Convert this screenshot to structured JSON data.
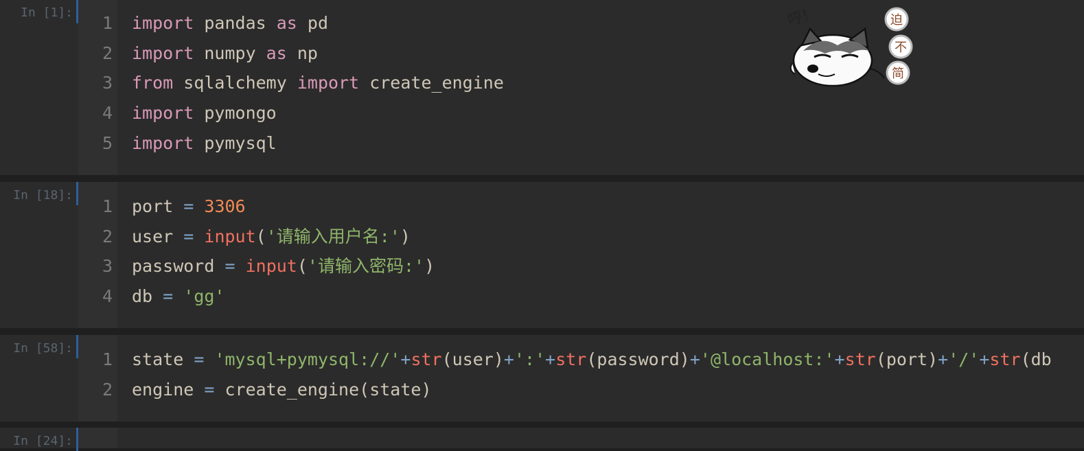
{
  "cells": [
    {
      "prompt": "In [1]:",
      "lines": [
        {
          "n": "1",
          "tokens": [
            {
              "t": "import",
              "c": "kw"
            },
            {
              "t": " pandas ",
              "c": "plain"
            },
            {
              "t": "as",
              "c": "kw"
            },
            {
              "t": " pd",
              "c": "plain"
            }
          ]
        },
        {
          "n": "2",
          "tokens": [
            {
              "t": "import",
              "c": "kw"
            },
            {
              "t": " numpy ",
              "c": "plain"
            },
            {
              "t": "as",
              "c": "kw"
            },
            {
              "t": " np",
              "c": "plain"
            }
          ]
        },
        {
          "n": "3",
          "tokens": [
            {
              "t": "from",
              "c": "kw"
            },
            {
              "t": " sqlalchemy ",
              "c": "plain"
            },
            {
              "t": "import",
              "c": "kw"
            },
            {
              "t": " create_engine",
              "c": "plain"
            }
          ]
        },
        {
          "n": "4",
          "tokens": [
            {
              "t": "import",
              "c": "kw"
            },
            {
              "t": " pymongo",
              "c": "plain"
            }
          ]
        },
        {
          "n": "5",
          "tokens": [
            {
              "t": "import",
              "c": "kw"
            },
            {
              "t": " pymysql",
              "c": "plain"
            }
          ]
        }
      ]
    },
    {
      "prompt": "In [18]:",
      "lines": [
        {
          "n": "1",
          "tokens": [
            {
              "t": "port ",
              "c": "plain"
            },
            {
              "t": "=",
              "c": "op"
            },
            {
              "t": " ",
              "c": "plain"
            },
            {
              "t": "3306",
              "c": "num"
            }
          ]
        },
        {
          "n": "2",
          "tokens": [
            {
              "t": "user ",
              "c": "plain"
            },
            {
              "t": "=",
              "c": "op"
            },
            {
              "t": " ",
              "c": "plain"
            },
            {
              "t": "input",
              "c": "fn"
            },
            {
              "t": "(",
              "c": "plain"
            },
            {
              "t": "'请输入用户名:'",
              "c": "str"
            },
            {
              "t": ")",
              "c": "plain"
            }
          ]
        },
        {
          "n": "3",
          "tokens": [
            {
              "t": "password ",
              "c": "plain"
            },
            {
              "t": "=",
              "c": "op"
            },
            {
              "t": " ",
              "c": "plain"
            },
            {
              "t": "input",
              "c": "fn"
            },
            {
              "t": "(",
              "c": "plain"
            },
            {
              "t": "'请输入密码:'",
              "c": "str"
            },
            {
              "t": ")",
              "c": "plain"
            }
          ]
        },
        {
          "n": "4",
          "tokens": [
            {
              "t": "db ",
              "c": "plain"
            },
            {
              "t": "=",
              "c": "op"
            },
            {
              "t": " ",
              "c": "plain"
            },
            {
              "t": "'gg'",
              "c": "str"
            }
          ]
        }
      ]
    },
    {
      "prompt": "In [58]:",
      "lines": [
        {
          "n": "1",
          "tokens": [
            {
              "t": "state ",
              "c": "plain"
            },
            {
              "t": "=",
              "c": "op"
            },
            {
              "t": " ",
              "c": "plain"
            },
            {
              "t": "'mysql+pymysql://'",
              "c": "str"
            },
            {
              "t": "+",
              "c": "op"
            },
            {
              "t": "str",
              "c": "fn"
            },
            {
              "t": "(user)",
              "c": "plain"
            },
            {
              "t": "+",
              "c": "op"
            },
            {
              "t": "':'",
              "c": "str"
            },
            {
              "t": "+",
              "c": "op"
            },
            {
              "t": "str",
              "c": "fn"
            },
            {
              "t": "(password)",
              "c": "plain"
            },
            {
              "t": "+",
              "c": "op"
            },
            {
              "t": "'@localhost:'",
              "c": "str"
            },
            {
              "t": "+",
              "c": "op"
            },
            {
              "t": "str",
              "c": "fn"
            },
            {
              "t": "(port)",
              "c": "plain"
            },
            {
              "t": "+",
              "c": "op"
            },
            {
              "t": "'/'",
              "c": "str"
            },
            {
              "t": "+",
              "c": "op"
            },
            {
              "t": "str",
              "c": "fn"
            },
            {
              "t": "(db",
              "c": "plain"
            }
          ]
        },
        {
          "n": "2",
          "tokens": [
            {
              "t": "engine ",
              "c": "plain"
            },
            {
              "t": "=",
              "c": "op"
            },
            {
              "t": " create_engine(state)",
              "c": "plain"
            }
          ]
        }
      ]
    },
    {
      "prompt": "In [24]:",
      "lines": []
    }
  ],
  "sticker": {
    "speech": "哼!",
    "badges": [
      "迫",
      "不",
      "简"
    ],
    "icon": "husky-sticker-icon"
  },
  "colors": {
    "keyword": "#d99ab7",
    "number": "#f08a55",
    "string": "#8fb56a",
    "builtin": "#f07060",
    "operator": "#7fa3c7",
    "text": "#cfc7b7",
    "cell_bar": "#2f5f99"
  }
}
